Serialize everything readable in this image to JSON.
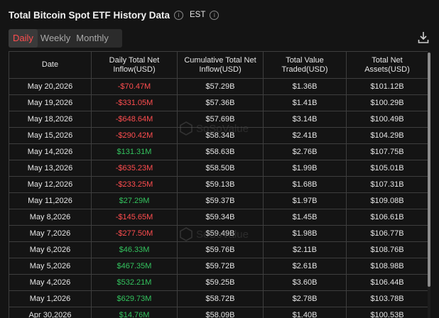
{
  "header": {
    "title": "Total Bitcoin Spot ETF History Data",
    "timezone": "EST"
  },
  "tabs": [
    {
      "label": "Daily",
      "active": true
    },
    {
      "label": "Weekly",
      "active": false
    },
    {
      "label": "Monthly",
      "active": false
    }
  ],
  "table": {
    "columns": [
      "Date",
      "Daily Total Net Inflow(USD)",
      "Cumulative Total Net Inflow(USD)",
      "Total Value Traded(USD)",
      "Total Net Assets(USD)"
    ],
    "rows": [
      [
        "May 20,2026",
        "-$70.47M",
        "$57.29B",
        "$1.36B",
        "$101.12B"
      ],
      [
        "May 19,2026",
        "-$331.05M",
        "$57.36B",
        "$1.41B",
        "$100.29B"
      ],
      [
        "May 18,2026",
        "-$648.64M",
        "$57.69B",
        "$3.14B",
        "$100.49B"
      ],
      [
        "May 15,2026",
        "-$290.42M",
        "$58.34B",
        "$2.41B",
        "$104.29B"
      ],
      [
        "May 14,2026",
        "$131.31M",
        "$58.63B",
        "$2.76B",
        "$107.75B"
      ],
      [
        "May 13,2026",
        "-$635.23M",
        "$58.50B",
        "$1.99B",
        "$105.01B"
      ],
      [
        "May 12,2026",
        "-$233.25M",
        "$59.13B",
        "$1.68B",
        "$107.31B"
      ],
      [
        "May 11,2026",
        "$27.29M",
        "$59.37B",
        "$1.97B",
        "$109.08B"
      ],
      [
        "May 8,2026",
        "-$145.65M",
        "$59.34B",
        "$1.45B",
        "$106.61B"
      ],
      [
        "May 7,2026",
        "-$277.50M",
        "$59.49B",
        "$1.98B",
        "$106.77B"
      ],
      [
        "May 6,2026",
        "$46.33M",
        "$59.76B",
        "$2.11B",
        "$108.76B"
      ],
      [
        "May 5,2026",
        "$467.35M",
        "$59.72B",
        "$2.61B",
        "$108.98B"
      ],
      [
        "May 4,2026",
        "$532.21M",
        "$59.25B",
        "$3.60B",
        "$106.44B"
      ],
      [
        "May 1,2026",
        "$629.73M",
        "$58.72B",
        "$2.78B",
        "$103.78B"
      ],
      [
        "Apr 30,2026",
        "$14.76M",
        "$58.09B",
        "$1.40B",
        "$100.53B"
      ]
    ]
  },
  "watermark": "SoSoValue",
  "colors": {
    "negative": "#ff4d4f",
    "positive": "#33c35e",
    "active_tab": "#ff4d4f"
  },
  "icons": {
    "info": "info-circle-icon",
    "download": "download-icon"
  }
}
